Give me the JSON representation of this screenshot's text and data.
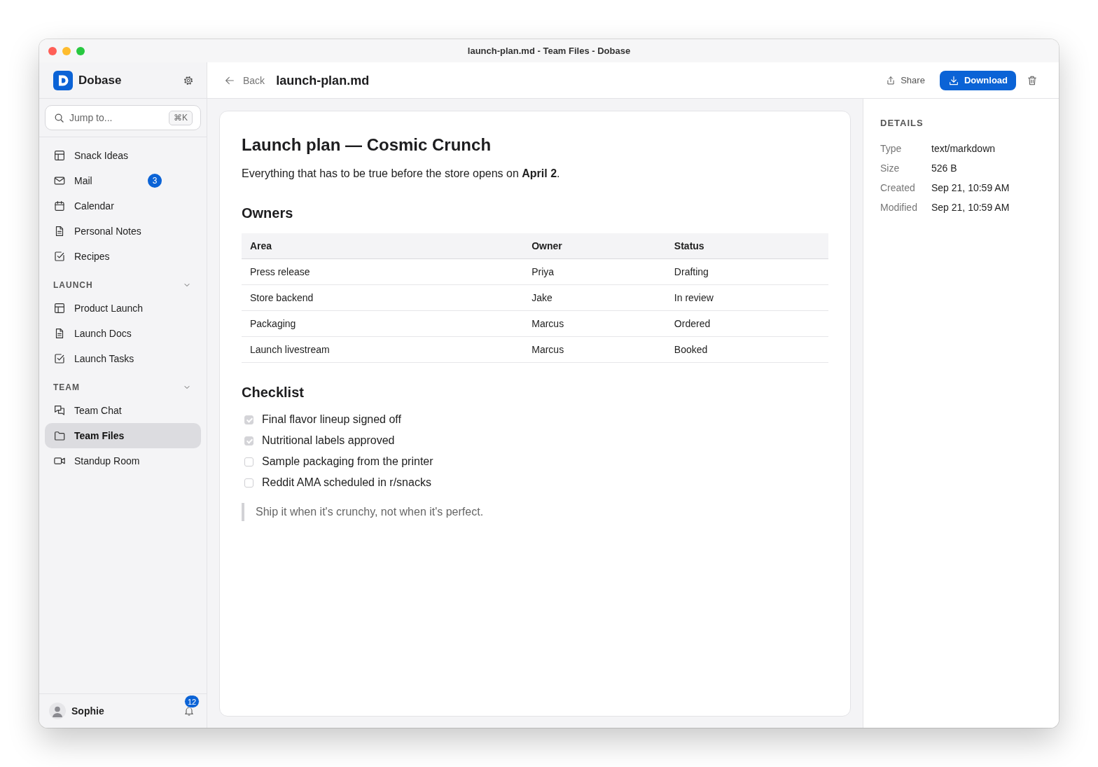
{
  "window": {
    "title": "launch-plan.md - Team Files - Dobase"
  },
  "sidebar": {
    "brand": "Dobase",
    "search": {
      "placeholder": "Jump to...",
      "shortcut": "⌘K"
    },
    "items": [
      {
        "kind": "board",
        "label": "Snack Ideas",
        "selected": false
      },
      {
        "kind": "mail",
        "label": "Mail",
        "badge": "3",
        "selected": false
      },
      {
        "kind": "calendar",
        "label": "Calendar",
        "selected": false
      },
      {
        "kind": "doc",
        "label": "Personal Notes",
        "selected": false
      },
      {
        "kind": "tasks",
        "label": "Recipes",
        "selected": false
      }
    ],
    "sections": [
      {
        "title": "LAUNCH",
        "expanded": true,
        "items": [
          {
            "kind": "board",
            "label": "Product Launch",
            "selected": false
          },
          {
            "kind": "doc",
            "label": "Launch Docs",
            "selected": false
          },
          {
            "kind": "tasks",
            "label": "Launch Tasks",
            "selected": false
          }
        ]
      },
      {
        "title": "TEAM",
        "expanded": true,
        "items": [
          {
            "kind": "chat",
            "label": "Team Chat",
            "selected": false
          },
          {
            "kind": "folder",
            "label": "Team Files",
            "selected": true
          },
          {
            "kind": "video",
            "label": "Standup Room",
            "selected": false
          }
        ]
      }
    ],
    "user": {
      "name": "Sophie",
      "notifications": "12"
    }
  },
  "toolbar": {
    "back": "Back",
    "file_name": "launch-plan.md",
    "share": "Share",
    "download": "Download"
  },
  "document": {
    "title": "Launch plan — Cosmic Crunch",
    "intro": "Everything that has to be true before the store opens on **April 2**.",
    "owners": {
      "heading": "Owners",
      "columns": [
        "Area",
        "Owner",
        "Status"
      ],
      "rows": [
        [
          "Press release",
          "Priya",
          "Drafting"
        ],
        [
          "Store backend",
          "Jake",
          "In review"
        ],
        [
          "Packaging",
          "Marcus",
          "Ordered"
        ],
        [
          "Launch livestream",
          "Marcus",
          "Booked"
        ]
      ]
    },
    "checklist": {
      "heading": "Checklist",
      "items": [
        {
          "label": "Final flavor lineup signed off",
          "checked": true
        },
        {
          "label": "Nutritional labels approved",
          "checked": true
        },
        {
          "label": "Sample packaging from the printer",
          "checked": false
        },
        {
          "label": "Reddit AMA scheduled in r/snacks",
          "checked": false
        }
      ]
    },
    "quote": "Ship it when it's crunchy, not when it's perfect."
  },
  "details": {
    "heading": "DETAILS",
    "rows": [
      {
        "label": "Type",
        "value": "text/markdown"
      },
      {
        "label": "Size",
        "value": "526 B"
      },
      {
        "label": "Created",
        "value": "Sep 21, 10:59 AM"
      },
      {
        "label": "Modified",
        "value": "Sep 21, 10:59 AM"
      }
    ]
  }
}
